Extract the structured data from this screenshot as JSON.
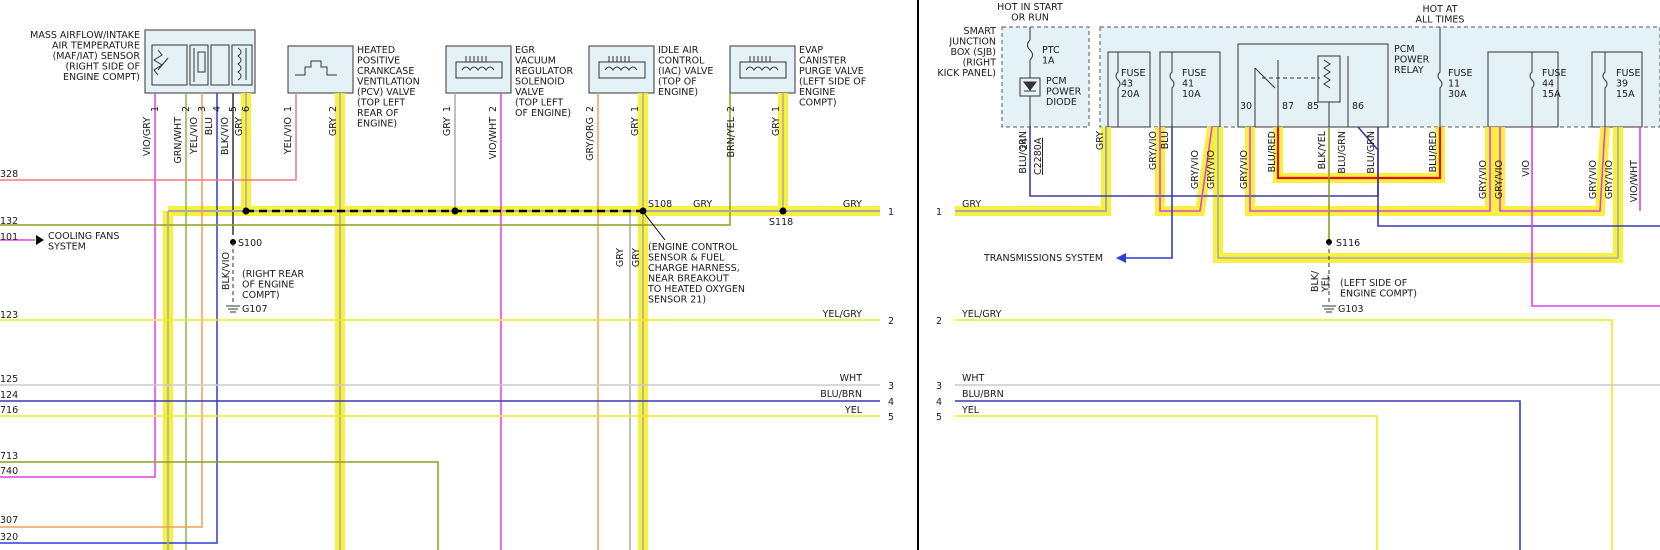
{
  "colors": {
    "gry": "#aaaaaa",
    "highlight": "#f7f02a",
    "yel": "#f2ea1a",
    "vio": "#e040e0",
    "blu": "#2a3fd0",
    "bluBrn": "#3a3ab0",
    "orange": "#f0a050",
    "green": "#7fbf3f",
    "olive": "#8aa020",
    "red": "#e01010",
    "pink": "#f07a8a",
    "wht": "#cccccc",
    "black": "#000000",
    "divider": "#000000"
  },
  "left": {
    "edge_codes": [
      "328",
      "132",
      "101",
      "123",
      "125",
      "124",
      "716",
      "713",
      "740",
      "307",
      "320"
    ],
    "cooling_fans": "COOLING FANS\nSYSTEM",
    "components": {
      "maf": "MASS AIRFLOW/INTAKE\nAIR TEMPERATURE\n(MAF/IAT) SENSOR\n(RIGHT SIDE OF\nENGINE COMPT)",
      "pcv": "HEATED\nPOSITIVE\nCRANKCASE\nVENTILATION\n(PCV) VALVE\n(TOP LEFT\nREAR OF\nENGINE)",
      "egr": "EGR\nVACUUM\nREGULATOR\nSOLENOID\nVALVE\n(TOP LEFT\nOF ENGINE)",
      "iac": "IDLE AIR\nCONTROL\n(IAC) VALVE\n(TOP OF\nENGINE)",
      "evap": "EVAP\nCANISTER\nPURGE VALVE\n(LEFT SIDE OF\nENGINE\nCOMPT)"
    },
    "pin_numbers": {
      "maf": [
        "1",
        "2",
        "3",
        "4",
        "5",
        "6"
      ],
      "pcv": [
        "1",
        "2"
      ],
      "egr": [
        "1",
        "2"
      ],
      "iac": [
        "2",
        "1"
      ],
      "evap": [
        "2",
        "1"
      ]
    },
    "wire_names": {
      "maf": [
        "VIO/GRY",
        "GRN/WHT",
        "YEL/VIO",
        "BLU",
        "BLK/VIO",
        "GRY"
      ],
      "pcv": [
        "YEL/VIO",
        "GRY"
      ],
      "egr": [
        "GRY",
        "VIO/WHT"
      ],
      "iac": [
        "GRY/ORG",
        "GRY"
      ],
      "evap": [
        "BRN/YEL",
        "GRY"
      ]
    },
    "splices": {
      "s108": "S108",
      "s118": "S118",
      "s100": "S100",
      "g107": "G107"
    },
    "splice_notes": {
      "s100_loc": "(RIGHT REAR\nOF ENGINE\nCOMPT)",
      "s108_loc": "(ENGINE CONTROL\nSENSOR & FUEL\nCHARGE HARNESS,\nNEAR BREAKOUT\nTO HEATED OXYGEN\nSENSOR 21)"
    },
    "vertical_labels": {
      "blk_vio": "BLK/VIO",
      "gry_a": "GRY",
      "gry_b": "GRY"
    },
    "trunk_labels": {
      "gry_mid": "GRY",
      "gry_right": "GRY",
      "yel_gry": "YEL/GRY",
      "wht": "WHT",
      "blu_brn": "BLU/BRN",
      "yel": "YEL"
    },
    "refs": [
      "1",
      "2",
      "3",
      "4",
      "5"
    ]
  },
  "right": {
    "hot_start": "HOT IN START\nOR RUN",
    "hot_all": "HOT AT\nALL TIMES",
    "sjb": "SMART\nJUNCTION\nBOX (SJB)\n(RIGHT\nKICK PANEL)",
    "ptc": "PTC\n1A",
    "diode": "PCM\nPOWER\nDIODE",
    "relay": "PCM\nPOWER\nRELAY",
    "relay_pins": [
      "30",
      "87",
      "85",
      "86"
    ],
    "fuses": [
      {
        "name": "FUSE\n43\n20A"
      },
      {
        "name": "FUSE\n41\n10A"
      },
      {
        "name": "FUSE\n11\n30A"
      },
      {
        "name": "FUSE\n44\n15A"
      },
      {
        "name": "FUSE\n39\n15A"
      }
    ],
    "wire_names": [
      "BLU/GRN",
      "GRY",
      "GRY/VIO",
      "BLU",
      "GRY/VIO",
      "GRY/VIO",
      "GRY/VIO",
      "BLU/RED",
      "BLK/YEL",
      "BLU/GRN",
      "BLU/GRN",
      "BLU/RED",
      "GRY/VIO",
      "GRY/VIO",
      "VIO",
      "GRY/VIO",
      "GRY/VIO",
      "VIO/WHT"
    ],
    "pin24": "24",
    "connector": "C2280A",
    "transmissions": "TRANSMISSIONS SYSTEM",
    "s116": "S116",
    "s116_wire": "BLK/\nYEL",
    "g103": "G103",
    "g103_loc": "(LEFT SIDE OF\nENGINE COMPT)",
    "trunk_labels": {
      "gry": "GRY",
      "yel_gry": "YEL/GRY",
      "wht": "WHT",
      "blu_brn": "BLU/BRN",
      "yel": "YEL"
    },
    "refs": [
      "1",
      "2",
      "3",
      "4",
      "5"
    ]
  }
}
